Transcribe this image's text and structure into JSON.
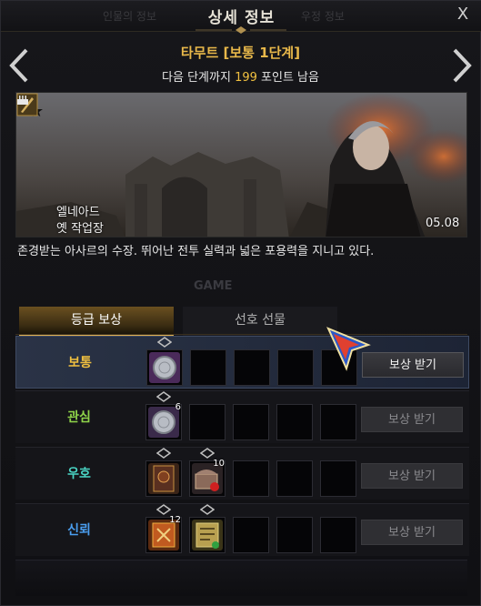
{
  "window": {
    "title": "상세 정보",
    "close_label": "X",
    "ghost_tabs": [
      "인물의 정보",
      "우정 정보"
    ]
  },
  "character": {
    "name": "타무트 [보통 1단계]",
    "points_prefix": "다음 단계까지 ",
    "points_value": "199",
    "points_suffix": " 포인트 남음",
    "region": "엘네아드",
    "place": "옛 작업장",
    "birthday": "05.08",
    "description": "존경받는 아사르의 수장. 뛰어난 전투 실력과 넓은 포용력을 지니고 있다."
  },
  "watermark": "GAME",
  "tabs": [
    {
      "label": "등급 보상",
      "active": true
    },
    {
      "label": "선호 선물",
      "active": false
    }
  ],
  "rewards": [
    {
      "grade": "보통",
      "color": "#f0c040",
      "selected": true,
      "button": "보상 받기",
      "items": [
        {
          "icon": "silver-coin-icon",
          "count": ""
        }
      ]
    },
    {
      "grade": "관심",
      "color": "#8fd44a",
      "selected": false,
      "button": "보상 받기",
      "items": [
        {
          "icon": "silver-coin-icon",
          "count": "6"
        }
      ]
    },
    {
      "grade": "우호",
      "color": "#4ad4c4",
      "selected": false,
      "button": "보상 받기",
      "items": [
        {
          "icon": "card-book-icon",
          "count": ""
        },
        {
          "icon": "treasure-chest-icon",
          "count": "10"
        }
      ]
    },
    {
      "grade": "신뢰",
      "color": "#4a9ef0",
      "selected": false,
      "button": "보상 받기",
      "items": [
        {
          "icon": "spell-book-icon",
          "count": "12"
        },
        {
          "icon": "map-scroll-icon",
          "count": ""
        }
      ]
    }
  ]
}
